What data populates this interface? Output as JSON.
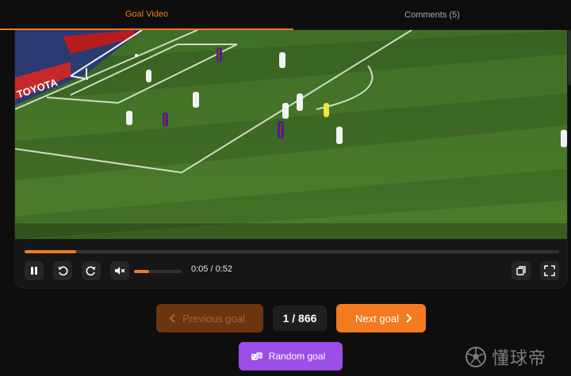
{
  "tabs": {
    "goal_video": "Goal Video",
    "comments": "Comments (5)"
  },
  "video": {
    "scene": "soccer-match-goal-clip",
    "ad_boards": [
      "TOYOTA"
    ]
  },
  "player": {
    "progress_fraction": 0.096,
    "volume_fraction": 0.32,
    "time_display": "0:05 / 0:52",
    "icons": {
      "play_pause": "pause-icon",
      "rewind": "rewind-icon",
      "forward": "forward-icon",
      "mute": "mute-icon",
      "pip": "pip-icon",
      "fullscreen": "fullscreen-icon"
    }
  },
  "navigation": {
    "previous_label": "Previous goal",
    "counter": "1 / 866",
    "next_label": "Next goal",
    "random_label": "Random goal"
  },
  "watermark": {
    "text": "懂球帝"
  },
  "colors": {
    "accent": "#f07a22",
    "random_button": "#9b4ee8",
    "prev_disabled": "#6b3510",
    "background": "#0e0e0e"
  }
}
